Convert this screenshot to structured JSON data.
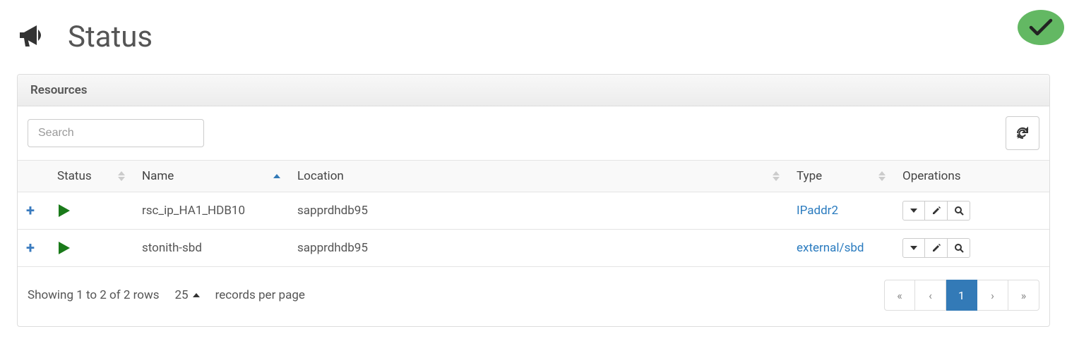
{
  "header": {
    "title": "Status"
  },
  "panel": {
    "heading": "Resources"
  },
  "search": {
    "placeholder": "Search",
    "value": ""
  },
  "table": {
    "columns": {
      "status": "Status",
      "name": "Name",
      "location": "Location",
      "type": "Type",
      "operations": "Operations"
    },
    "rows": [
      {
        "name": "rsc_ip_HA1_HDB10",
        "location": "sapprdhdb95",
        "type": "IPaddr2"
      },
      {
        "name": "stonith-sbd",
        "location": "sapprdhdb95",
        "type": "external/sbd"
      }
    ]
  },
  "footer": {
    "showing": "Showing 1 to 2 of 2 rows",
    "page_size": "25",
    "records_label": "records per page"
  },
  "pagination": {
    "first": "«",
    "prev": "‹",
    "current": "1",
    "next": "›",
    "last": "»"
  }
}
